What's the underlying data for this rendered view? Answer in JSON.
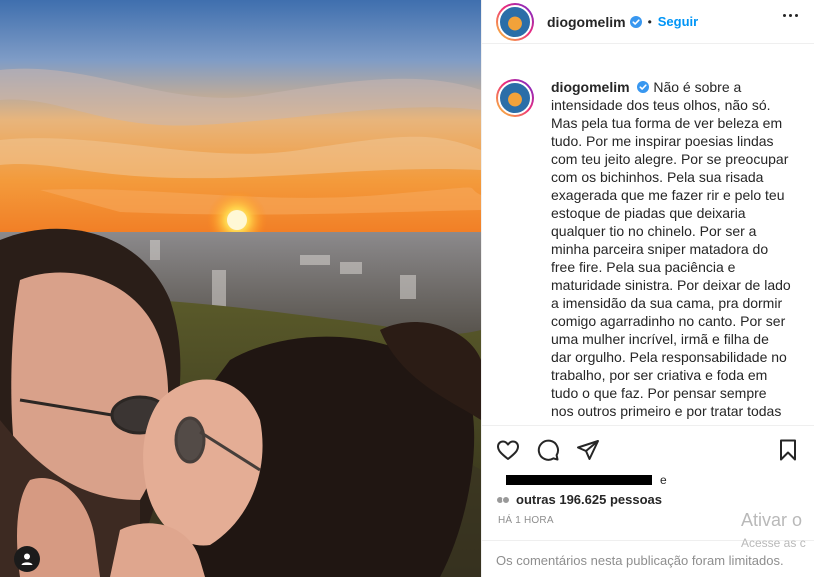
{
  "post": {
    "username": "diogomelim",
    "follow_label": "Seguir",
    "dot": "•",
    "caption_user": "diogomelim",
    "caption": "Não é sobre a intensidade dos teus olhos, não só. Mas pela tua forma de ver beleza em tudo. Por me inspirar poesias lindas com teu jeito alegre. Por se preocupar com os bichinhos. Pela sua risada exagerada que me fazer rir e pelo teu estoque de piadas que deixaria qualquer tio no chinelo. Por ser a minha parceira sniper matadora do free fire. Pela sua paciência e maturidade sinistra. Por deixar de lado a imensidão da sua cama, pra dormir comigo agarradinho no canto. Por ser uma mulher incrível, irmã e filha de dar orgulho. Pela responsabilidade no trabalho, por ser criativa e foda em tudo o que faz. Por pensar sempre nos outros primeiro e por tratar todas as",
    "likes_connector": "e",
    "likes_others": "outras 196.625 pessoas",
    "timestamp": "HÁ 1 HORA",
    "comments_notice": "Os comentários nesta publicação foram limitados."
  },
  "icons": {
    "verified": "verified-badge-icon",
    "more": "more-options-icon",
    "like": "heart-icon",
    "comment": "comment-bubble-icon",
    "share": "paper-plane-icon",
    "save": "bookmark-icon",
    "user_tag": "user-tag-icon"
  },
  "watermark": {
    "line1": "Ativar o",
    "line2": "Acesse as c"
  },
  "colors": {
    "accent": "#0095f6",
    "verified": "#3897f0",
    "text": "#262626",
    "muted": "#8e8e8e"
  }
}
